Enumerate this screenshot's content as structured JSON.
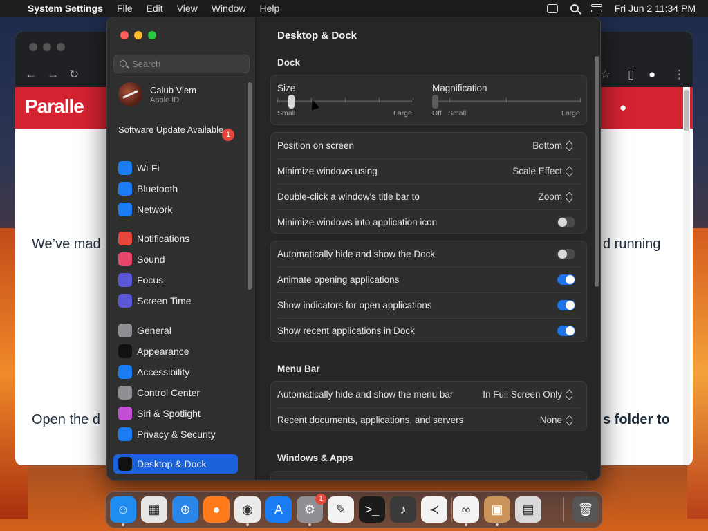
{
  "menubar": {
    "apple": "",
    "app_name": "System Settings",
    "menus": [
      "File",
      "Edit",
      "View",
      "Window",
      "Help"
    ],
    "datetime": "Fri Jun 2  11:34 PM"
  },
  "browser": {
    "logo_text": "Paralle",
    "text_left_1": "We’ve mad",
    "text_right_1": "d running",
    "text_left_2": "Open the d",
    "text_right_2": "s folder to"
  },
  "sidebar": {
    "search_placeholder": "Search",
    "profile": {
      "name": "Calub Viem",
      "subtitle": "Apple ID"
    },
    "update": {
      "label": "Software Update Available",
      "badge": "1"
    },
    "groups": [
      [
        {
          "label": "Wi-Fi",
          "icon": "wifi-icon",
          "color": "#1a7cf2"
        },
        {
          "label": "Bluetooth",
          "icon": "bluetooth-icon",
          "color": "#1a7cf2"
        },
        {
          "label": "Network",
          "icon": "globe-icon",
          "color": "#1a7cf2"
        }
      ],
      [
        {
          "label": "Notifications",
          "icon": "bell-icon",
          "color": "#e8453c"
        },
        {
          "label": "Sound",
          "icon": "speaker-icon",
          "color": "#e8456b"
        },
        {
          "label": "Focus",
          "icon": "moon-icon",
          "color": "#5b56d6"
        },
        {
          "label": "Screen Time",
          "icon": "hourglass-icon",
          "color": "#5b56d6"
        }
      ],
      [
        {
          "label": "General",
          "icon": "gear-icon",
          "color": "#8e8e93"
        },
        {
          "label": "Appearance",
          "icon": "appearance-icon",
          "color": "#111111"
        },
        {
          "label": "Accessibility",
          "icon": "accessibility-icon",
          "color": "#1a7cf2"
        },
        {
          "label": "Control Center",
          "icon": "control-center-icon",
          "color": "#8e8e93"
        },
        {
          "label": "Siri & Spotlight",
          "icon": "siri-icon",
          "color": "#c24fd6"
        },
        {
          "label": "Privacy & Security",
          "icon": "hand-icon",
          "color": "#1a7cf2"
        }
      ],
      [
        {
          "label": "Desktop & Dock",
          "icon": "dock-icon",
          "color": "#111111",
          "selected": true
        }
      ]
    ]
  },
  "main": {
    "title": "Desktop & Dock",
    "dock_section": "Dock",
    "size": {
      "label": "Size",
      "min": "Small",
      "max": "Large",
      "value": 0.1
    },
    "magnification": {
      "label": "Magnification",
      "off": "Off",
      "min": "Small",
      "max": "Large",
      "value": 0
    },
    "position_rows": [
      {
        "label": "Position on screen",
        "value": "Bottom"
      },
      {
        "label": "Minimize windows using",
        "value": "Scale Effect"
      },
      {
        "label": "Double-click a window's title bar to",
        "value": "Zoom"
      },
      {
        "label": "Minimize windows into application icon",
        "toggle": false
      }
    ],
    "behavior_rows": [
      {
        "label": "Automatically hide and show the Dock",
        "toggle": false
      },
      {
        "label": "Animate opening applications",
        "toggle": true
      },
      {
        "label": "Show indicators for open applications",
        "toggle": true
      },
      {
        "label": "Show recent applications in Dock",
        "toggle": true
      }
    ],
    "menubar_section": "Menu Bar",
    "menubar_rows": [
      {
        "label": "Automatically hide and show the menu bar",
        "value": "In Full Screen Only"
      },
      {
        "label": "Recent documents, applications, and servers",
        "value": "None"
      }
    ],
    "windows_section": "Windows & Apps"
  },
  "dock": {
    "apps": [
      {
        "name": "Finder",
        "icon": "finder-icon",
        "color": "#1f8cf0",
        "glyph": "☺"
      },
      {
        "name": "Launchpad",
        "icon": "launchpad-icon",
        "color": "#e5e5e5",
        "glyph": "▦"
      },
      {
        "name": "Safari",
        "icon": "safari-icon",
        "color": "#2a86e8",
        "glyph": "⊕"
      },
      {
        "name": "Firefox",
        "icon": "firefox-icon",
        "color": "#ff7b1c",
        "glyph": "●"
      },
      {
        "name": "Chrome",
        "icon": "chrome-icon",
        "color": "#eaeaea",
        "glyph": "◉"
      },
      {
        "name": "App Store",
        "icon": "app-store-icon",
        "color": "#1a7cf2",
        "glyph": "A"
      },
      {
        "name": "System Settings",
        "icon": "settings-icon",
        "color": "#8e8e93",
        "glyph": "⚙",
        "badge": "1"
      },
      {
        "name": "TextEdit",
        "icon": "textedit-icon",
        "color": "#f2f2f2",
        "glyph": "✎"
      },
      {
        "name": "Terminal",
        "icon": "terminal-icon",
        "color": "#1b1b1b",
        "glyph": ">_"
      },
      {
        "name": "GarageBand",
        "icon": "guitar-icon",
        "color": "#3a3a3a",
        "glyph": "♪"
      },
      {
        "name": "VS Code",
        "icon": "vscode-icon",
        "color": "#f3f3f3",
        "glyph": "≺"
      },
      {
        "name": "Visual Studio",
        "icon": "visual-studio-icon",
        "color": "#f3f3f3",
        "glyph": "∞"
      },
      {
        "name": "Parallels Installer",
        "icon": "parallels-box-icon",
        "color": "#c9935a",
        "glyph": "▣"
      },
      {
        "name": "Boot Camp",
        "icon": "boot-camp-icon",
        "color": "#d9d9d9",
        "glyph": "▤"
      },
      {
        "name": "Trash",
        "icon": "trash-icon",
        "color": "#555555",
        "glyph": "🗑"
      }
    ]
  }
}
